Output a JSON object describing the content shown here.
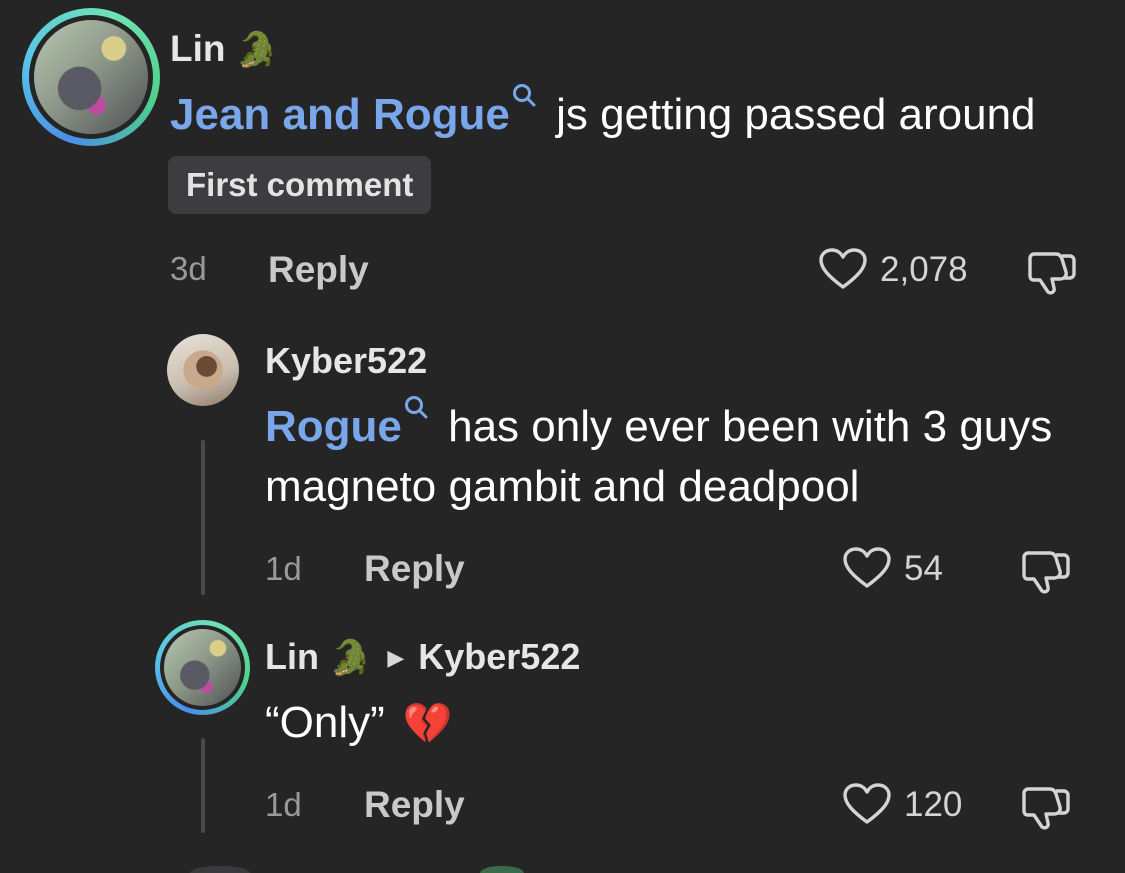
{
  "comments": [
    {
      "username": "Lin",
      "user_emoji": "🐊",
      "mention": "Jean and Rogue",
      "text": " js getting passed around",
      "badge": "First comment",
      "time": "3d",
      "reply_label": "Reply",
      "likes": "2,078"
    },
    {
      "username": "Kyber522",
      "mention": "Rogue",
      "text": " has only ever been with 3 guys magneto gambit and deadpool",
      "time": "1d",
      "reply_label": "Reply",
      "likes": "54"
    },
    {
      "username": "Lin",
      "user_emoji": "🐊",
      "reply_to_arrow": "▶",
      "reply_to": "Kyber522",
      "text": "“Only”",
      "text_emoji": "💔",
      "time": "1d",
      "reply_label": "Reply",
      "likes": "120"
    }
  ],
  "colors": {
    "background": "#252526",
    "mention": "#7aa7ec",
    "ring": "#4fd18b"
  },
  "icons": [
    "heart-icon",
    "dislike-icon",
    "search-icon"
  ]
}
